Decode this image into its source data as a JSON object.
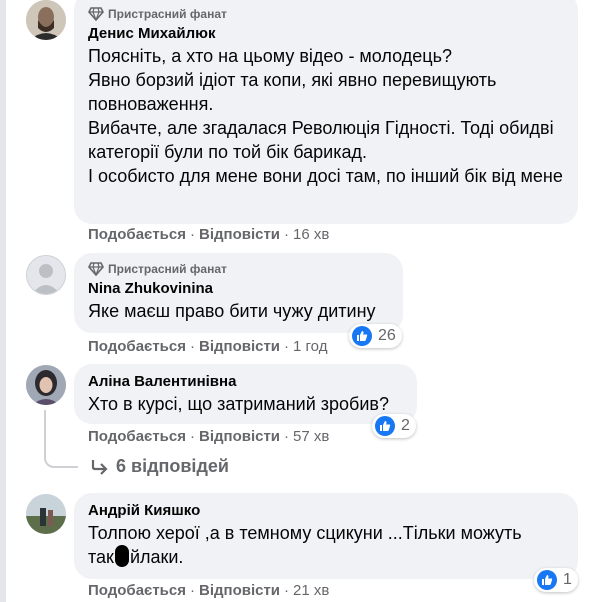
{
  "comments": [
    {
      "badge": "Пристрасний фанат",
      "author": "Денис Михайлюк",
      "lines": [
        "Поясніть, а хто на цьому відео - молодець?",
        "Явно борзий ідіот та копи, які явно перевищують повноваження.",
        "Вибачте, але згадалася Революція Гідності. Тоді обидві категорії були по той бік барикад.",
        "І особисто для мене вони досі там, по інший бік від мене"
      ],
      "like_label": "Подобається",
      "reply_label": "Відповісти",
      "time": "16 хв"
    },
    {
      "badge": "Пристрасний фанат",
      "author": "Nina Zhukovinina",
      "text": "Яке маєш право бити чужу дитину",
      "like_label": "Подобається",
      "reply_label": "Відповісти",
      "time": "1 год",
      "reactions": "26"
    },
    {
      "author": "Аліна Валентинівна",
      "text": "Хто в курсі, що затриманий зробив?",
      "like_label": "Подобається",
      "reply_label": "Відповісти",
      "time": "57 хв",
      "reactions": "2",
      "replies_label": "6 відповідей"
    },
    {
      "author": "Андрій Кияшко",
      "text_line1": "Толпою херої ,а в темному сцикуни ...Тільки можуть",
      "text_line2_before": "так",
      "text_line2_after": "йлаки.",
      "like_label": "Подобається",
      "reply_label": "Відповісти",
      "time": "21 хв",
      "reactions": "1"
    }
  ],
  "colors": {
    "bubble": "#f0f2f5",
    "secondary_text": "#65676b",
    "like_blue": "#1877f2"
  }
}
